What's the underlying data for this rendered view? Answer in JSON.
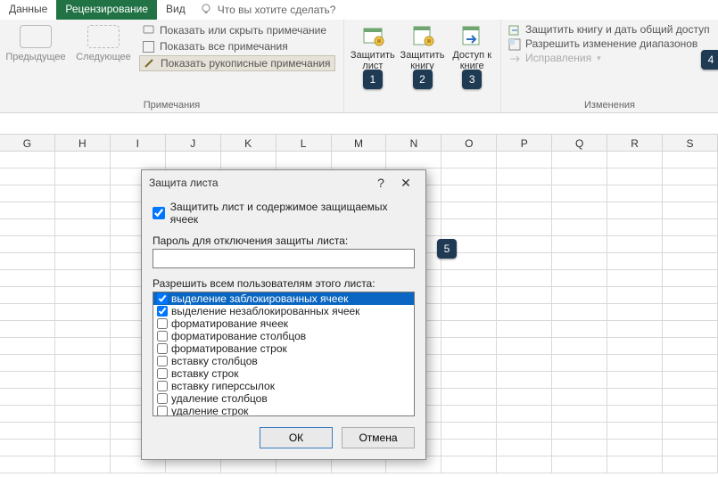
{
  "tabs": {
    "data": "Данные",
    "review": "Рецензирование",
    "view": "Вид"
  },
  "tell_me": "Что вы хотите сделать?",
  "ribbon": {
    "comments_group_label": "Примечания",
    "changes_group_label": "Изменения",
    "prev": "Предыдущее",
    "next": "Следующее",
    "show_hide": "Показать или скрыть примечание",
    "show_all": "Показать все примечания",
    "show_ink": "Показать рукописные примечания",
    "protect_sheet": "Защитить лист",
    "protect_book": "Защитить книгу",
    "share_book": "Доступ к книге",
    "protect_share": "Защитить книгу и дать общий доступ",
    "allow_ranges": "Разрешить изменение диапазонов",
    "track_changes": "Исправления"
  },
  "columns": [
    "G",
    "H",
    "I",
    "J",
    "K",
    "L",
    "M",
    "N",
    "O",
    "P",
    "Q",
    "R",
    "S"
  ],
  "dialog": {
    "title": "Защита листа",
    "protect_check": "Защитить лист и содержимое защищаемых ячеек",
    "password_label": "Пароль для отключения защиты листа:",
    "password_value": "",
    "perm_label": "Разрешить всем пользователям этого листа:",
    "perms": [
      {
        "label": "выделение заблокированных ячеек",
        "checked": true,
        "selected": true
      },
      {
        "label": "выделение незаблокированных ячеек",
        "checked": true
      },
      {
        "label": "форматирование ячеек",
        "checked": false
      },
      {
        "label": "форматирование столбцов",
        "checked": false
      },
      {
        "label": "форматирование строк",
        "checked": false
      },
      {
        "label": "вставку столбцов",
        "checked": false
      },
      {
        "label": "вставку строк",
        "checked": false
      },
      {
        "label": "вставку гиперссылок",
        "checked": false
      },
      {
        "label": "удаление столбцов",
        "checked": false
      },
      {
        "label": "удаление строк",
        "checked": false
      }
    ],
    "ok": "ОК",
    "cancel": "Отмена"
  },
  "badges": {
    "b1": "1",
    "b2": "2",
    "b3": "3",
    "b4": "4",
    "b5": "5"
  }
}
